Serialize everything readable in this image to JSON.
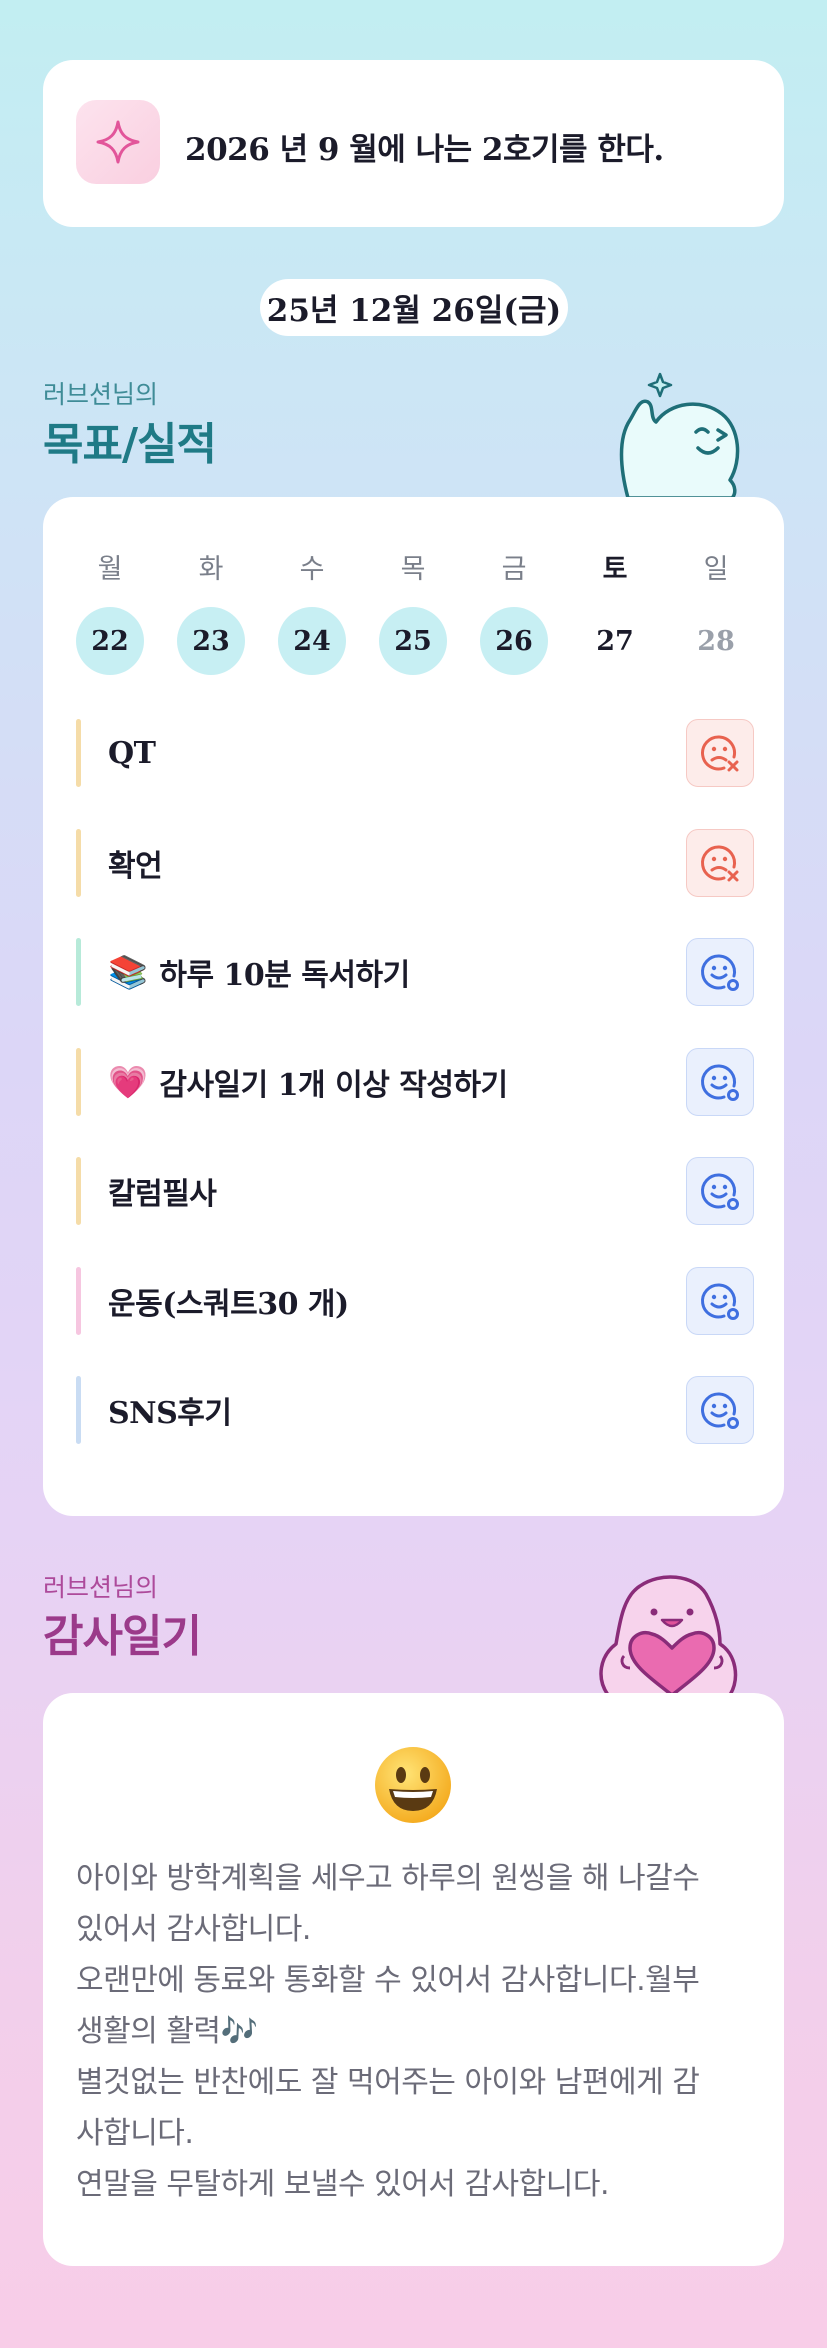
{
  "goal_card": {
    "icon": "sparkle-icon",
    "text": "2026 년 9 월에 나는 2호기를 한다."
  },
  "date_pill": "25년 12월 26일(금)",
  "goals_section": {
    "subtitle": "러브션님의",
    "title": "목표/실적"
  },
  "week": {
    "days": [
      {
        "day": "월",
        "date": "22",
        "state": "done"
      },
      {
        "day": "화",
        "date": "23",
        "state": "done"
      },
      {
        "day": "수",
        "date": "24",
        "state": "done"
      },
      {
        "day": "목",
        "date": "25",
        "state": "done"
      },
      {
        "day": "금",
        "date": "26",
        "state": "done"
      },
      {
        "day": "토",
        "date": "27",
        "state": "today"
      },
      {
        "day": "일",
        "date": "28",
        "state": "future"
      }
    ]
  },
  "goals": [
    {
      "emoji": "",
      "label": "QT",
      "bar_color": "#f5dca8",
      "status": "fail"
    },
    {
      "emoji": "",
      "label": "확언",
      "bar_color": "#f5dca8",
      "status": "fail"
    },
    {
      "emoji": "📚",
      "label": "하루 10분 독서하기",
      "bar_color": "#b7ead9",
      "status": "done"
    },
    {
      "emoji": "💗",
      "label": "감사일기 1개 이상 작성하기",
      "bar_color": "#f5dca8",
      "status": "done"
    },
    {
      "emoji": "",
      "label": "칼럼필사",
      "bar_color": "#f5dca8",
      "status": "done"
    },
    {
      "emoji": "",
      "label": "운동(스쿼트30 개)",
      "bar_color": "#f6c6e0",
      "status": "done"
    },
    {
      "emoji": "",
      "label": "SNS후기",
      "bar_color": "#c9dcf3",
      "status": "done"
    }
  ],
  "diary_section": {
    "subtitle": "러브션님의",
    "title": "감사일기"
  },
  "diary": {
    "mood_icon": "grinning-face-icon",
    "lines": [
      "아이와 방학계획을 세우고 하루의 원씽을 해 나갈수",
      "있어서 감사합니다.",
      "오랜만에 동료와 통화할 수 있어서 감사합니다.월부",
      "생활의 활력🎶",
      "별것없는 반찬에도 잘 먹어주는 아이와 남편에게 감",
      "사합니다.",
      "연말을 무탈하게 보낼수 있어서 감사합니다."
    ]
  },
  "colors": {
    "fail": "#e8624f",
    "done": "#3f6fe0",
    "teal_title": "#1f7a86",
    "plum_title": "#9b3a8a"
  }
}
